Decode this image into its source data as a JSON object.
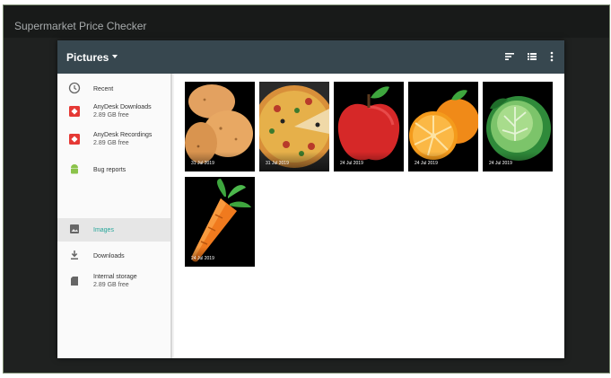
{
  "app": {
    "title": "Supermarket Price Checker"
  },
  "toolbar": {
    "title": "Pictures"
  },
  "sidebar": {
    "items": [
      {
        "label": "Recent",
        "sub": "",
        "icon": "clock-icon"
      },
      {
        "label": "AnyDesk Downloads",
        "sub": "2.89 GB free",
        "icon": "anydesk-icon"
      },
      {
        "label": "AnyDesk Recordings",
        "sub": "2.89 GB free",
        "icon": "anydesk-icon"
      },
      {
        "label": "Bug reports",
        "sub": "",
        "icon": "android-icon"
      },
      {
        "label": "Images",
        "sub": "",
        "icon": "image-icon",
        "active": true
      },
      {
        "label": "Downloads",
        "sub": "",
        "icon": "download-icon"
      },
      {
        "label": "Internal storage",
        "sub": "2.89 GB free",
        "icon": "sd-card-icon"
      }
    ]
  },
  "images": [
    {
      "date": "31 Jul 2019",
      "subject": "potato"
    },
    {
      "date": "31 Jul 2019",
      "subject": "pizza"
    },
    {
      "date": "24 Jul 2019",
      "subject": "apple"
    },
    {
      "date": "24 Jul 2019",
      "subject": "orange"
    },
    {
      "date": "24 Jul 2019",
      "subject": "cabbage"
    },
    {
      "date": "24 Jul 2019",
      "subject": "carrot"
    }
  ],
  "colors": {
    "toolbar": "#37474f",
    "accent": "#26a69a",
    "background": "#1f2120"
  }
}
